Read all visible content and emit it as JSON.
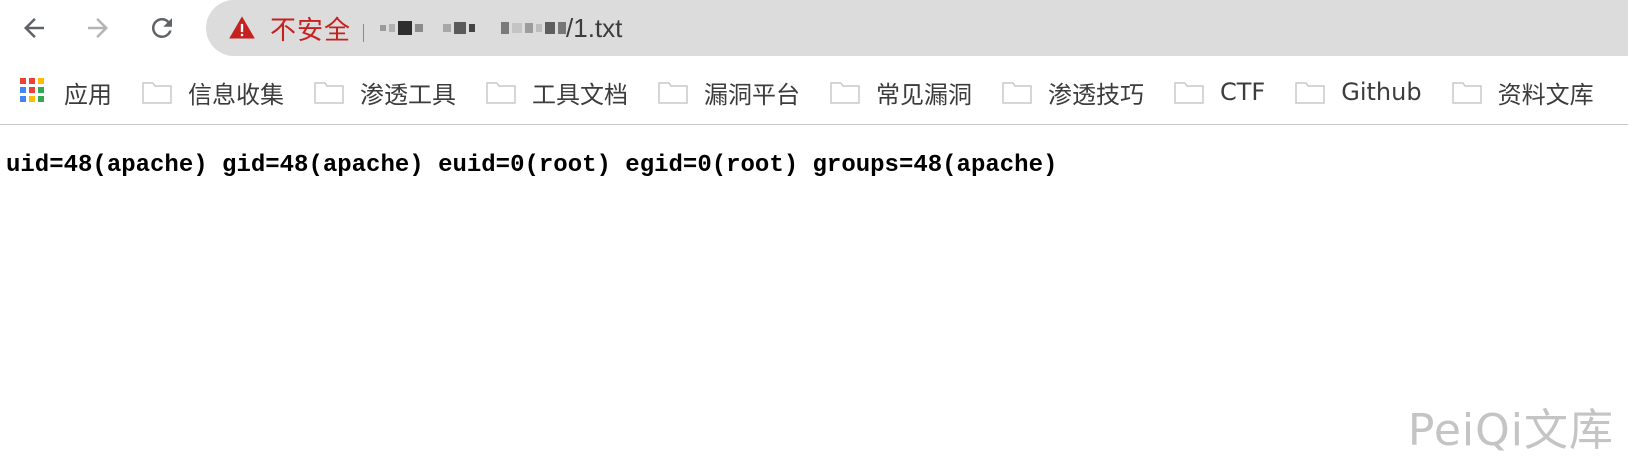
{
  "toolbar": {
    "back_icon": "arrow-left-icon",
    "forward_icon": "arrow-right-icon",
    "reload_icon": "reload-icon"
  },
  "omnibox": {
    "security_icon": "warning-triangle-icon",
    "security_label": "不安全",
    "url_visible_suffix": "/1.txt",
    "colors": {
      "security": "#c5221f",
      "background": "#dcdcdc"
    }
  },
  "bookmarks": {
    "apps_label": "应用",
    "items": [
      {
        "label": "信息收集"
      },
      {
        "label": "渗透工具"
      },
      {
        "label": "工具文档"
      },
      {
        "label": "漏洞平台"
      },
      {
        "label": "常见漏洞"
      },
      {
        "label": "渗透技巧"
      },
      {
        "label": "CTF"
      },
      {
        "label": "Github"
      },
      {
        "label": "资料文库"
      }
    ]
  },
  "page": {
    "text": "uid=48(apache) gid=48(apache) euid=0(root) egid=0(root) groups=48(apache)"
  },
  "watermark": "PeiQi文库"
}
